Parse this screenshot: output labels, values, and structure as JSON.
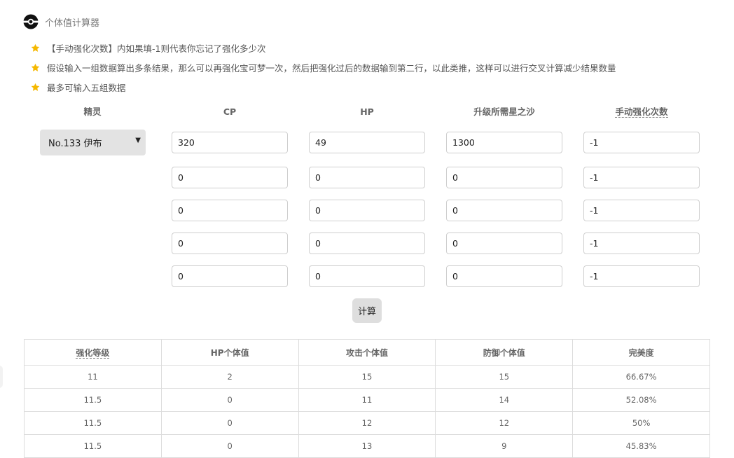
{
  "app": {
    "title": "个体值计算器",
    "logo_icon": "pokeball-icon"
  },
  "colors": {
    "star": "#f5b800",
    "button_bg": "#dedede",
    "select_bg": "#e3e3e3",
    "border": "#cfcfcf"
  },
  "tips": [
    "【手动强化次数】内如果填-1则代表你忘记了强化多少次",
    "假设输入一组数据算出多条结果，那么可以再强化宝可梦一次，然后把强化过后的数据输到第二行，以此类推，这样可以进行交叉计算减少结果数量",
    "最多可输入五组数据"
  ],
  "form": {
    "headers": {
      "pokemon": "精灵",
      "cp": "CP",
      "hp": "HP",
      "stardust": "升级所需星之沙",
      "power_ups": "手动强化次数"
    },
    "pokemon_select": {
      "selected": "No.133 伊布",
      "arrow_icon": "triangle-down-icon"
    },
    "rows": [
      {
        "cp": "320",
        "hp": "49",
        "stardust": "1300",
        "power_ups": "-1"
      },
      {
        "cp": "0",
        "hp": "0",
        "stardust": "0",
        "power_ups": "-1"
      },
      {
        "cp": "0",
        "hp": "0",
        "stardust": "0",
        "power_ups": "-1"
      },
      {
        "cp": "0",
        "hp": "0",
        "stardust": "0",
        "power_ups": "-1"
      },
      {
        "cp": "0",
        "hp": "0",
        "stardust": "0",
        "power_ups": "-1"
      }
    ],
    "calculate_label": "计算"
  },
  "results": {
    "headers": [
      "强化等级",
      "HP个体值",
      "攻击个体值",
      "防御个体值",
      "完美度"
    ],
    "rows": [
      [
        "11",
        "2",
        "15",
        "15",
        "66.67%"
      ],
      [
        "11.5",
        "0",
        "11",
        "14",
        "52.08%"
      ],
      [
        "11.5",
        "0",
        "12",
        "12",
        "50%"
      ],
      [
        "11.5",
        "0",
        "13",
        "9",
        "45.83%"
      ]
    ]
  }
}
